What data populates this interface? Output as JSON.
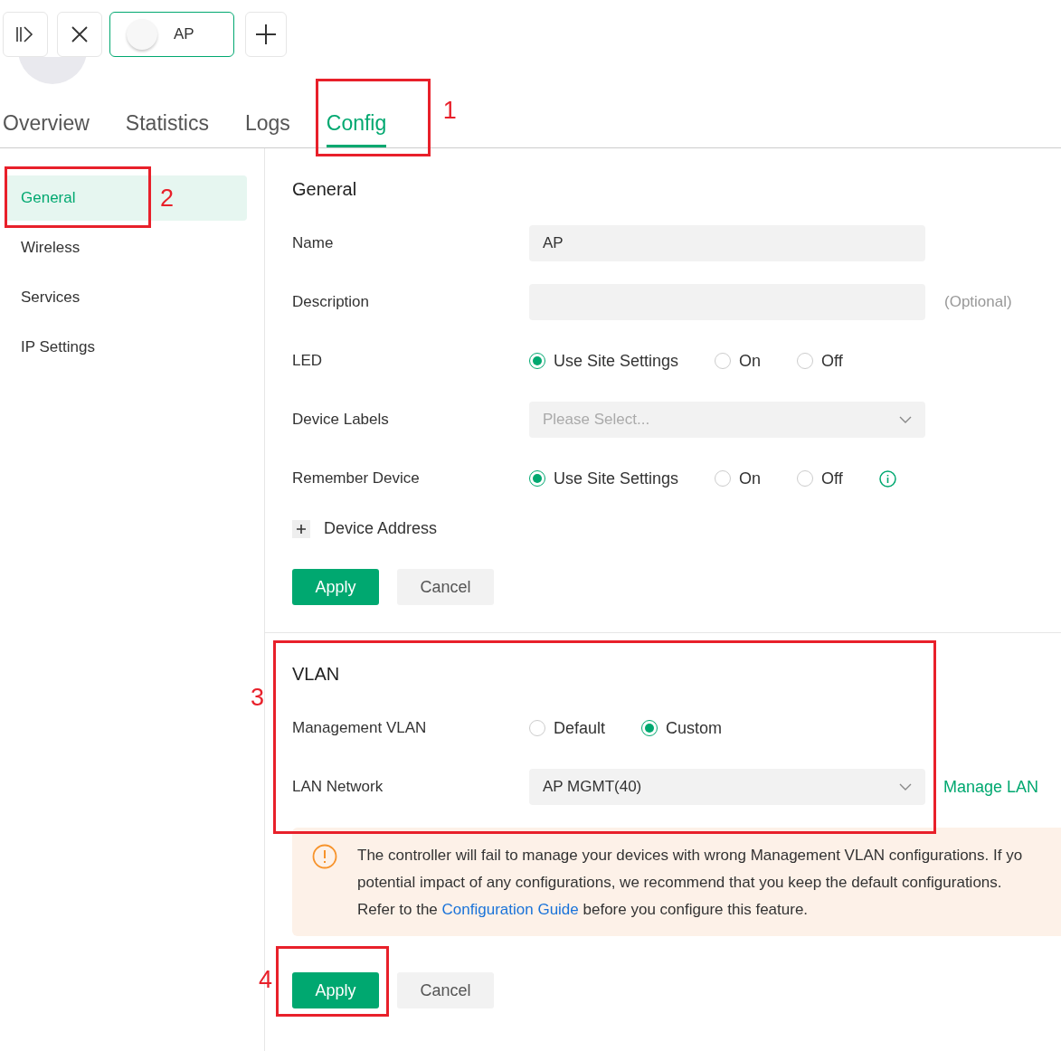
{
  "device_tab": {
    "label": "AP",
    "selected": true
  },
  "tabs": [
    {
      "label": "Overview",
      "selected": false
    },
    {
      "label": "Statistics",
      "selected": false
    },
    {
      "label": "Logs",
      "selected": false
    },
    {
      "label": "Config",
      "selected": true,
      "annotation": "1"
    }
  ],
  "sidebar": {
    "items": [
      {
        "label": "General",
        "selected": true,
        "annotation": "2"
      },
      {
        "label": "Wireless",
        "selected": false
      },
      {
        "label": "Services",
        "selected": false
      },
      {
        "label": "IP Settings",
        "selected": false
      }
    ]
  },
  "general": {
    "title": "General",
    "fields": [
      {
        "kind": "text",
        "label": "Name",
        "value": "AP"
      },
      {
        "kind": "text",
        "label": "Description",
        "hint": "(Optional)"
      },
      {
        "kind": "radio",
        "label": "LED",
        "options": [
          {
            "label": "Use Site Settings",
            "selected": true
          },
          {
            "label": "On",
            "selected": false
          },
          {
            "label": "Off",
            "selected": false
          }
        ]
      },
      {
        "kind": "select",
        "label": "Device Labels",
        "placeholder": "Please Select..."
      },
      {
        "kind": "radio",
        "label": "Remember Device",
        "info": true,
        "options": [
          {
            "label": "Use Site Settings",
            "selected": true
          },
          {
            "label": "On",
            "selected": false
          },
          {
            "label": "Off",
            "selected": false
          }
        ]
      }
    ],
    "expander": {
      "label": "Device Address",
      "expanded": false
    },
    "buttons": [
      {
        "kind": "primary",
        "label": "Apply"
      },
      {
        "kind": "secondary",
        "label": "Cancel"
      }
    ]
  },
  "vlan": {
    "title": "VLAN",
    "annotation": "3",
    "fields": [
      {
        "kind": "radio",
        "label": "Management VLAN",
        "options": [
          {
            "label": "Default",
            "selected": false
          },
          {
            "label": "Custom",
            "selected": true
          }
        ]
      },
      {
        "kind": "select",
        "label": "LAN Network",
        "value": "AP MGMT(40)",
        "link": "Manage LAN"
      }
    ],
    "warning": {
      "lines": [
        "The controller will fail to manage your devices with wrong Management VLAN configurations. If yo",
        "potential impact of any configurations, we recommend that you keep the default configurations."
      ],
      "last_line": {
        "before": "Refer to the",
        "link": "Configuration Guide",
        "after": "before you configure this feature."
      }
    },
    "buttons": [
      {
        "kind": "primary",
        "label": "Apply",
        "annotation": "4"
      },
      {
        "kind": "secondary",
        "label": "Cancel"
      }
    ]
  }
}
